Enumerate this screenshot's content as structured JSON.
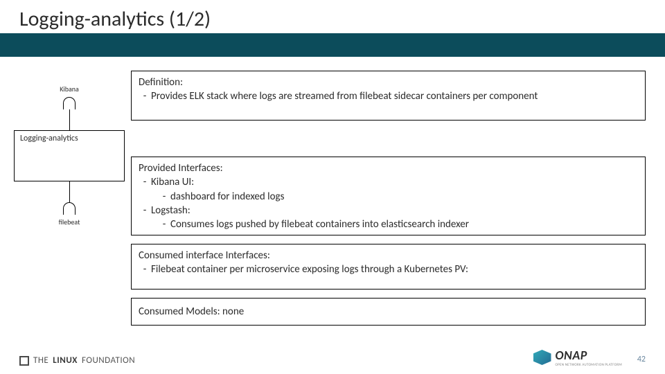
{
  "title": "Logging-analytics (1/2)",
  "diagram": {
    "top_label": "Kibana",
    "component": "Logging-analytics",
    "bottom_label": "filebeat"
  },
  "box1": {
    "heading": "Definition:",
    "item1": "Provides ELK stack where logs are streamed from filebeat sidecar containers per component"
  },
  "box2": {
    "heading": "Provided Interfaces:",
    "i1": "Kibana UI:",
    "i1a": "dashboard for indexed logs",
    "i2": "Logstash:",
    "i2a": "Consumes logs pushed by filebeat containers into elasticsearch indexer"
  },
  "box3": {
    "heading": "Consumed interface Interfaces:",
    "i1": "Filebeat container per microservice exposing logs through a Kubernetes PV:"
  },
  "box4": {
    "line": "Consumed Models: none"
  },
  "footer": {
    "linux1": "THE",
    "linux2": "LINUX",
    "linux3": "FOUNDATION",
    "onap": "ONAP",
    "onap_sub": "OPEN NETWORK AUTOMATION PLATFORM",
    "page": "42"
  }
}
